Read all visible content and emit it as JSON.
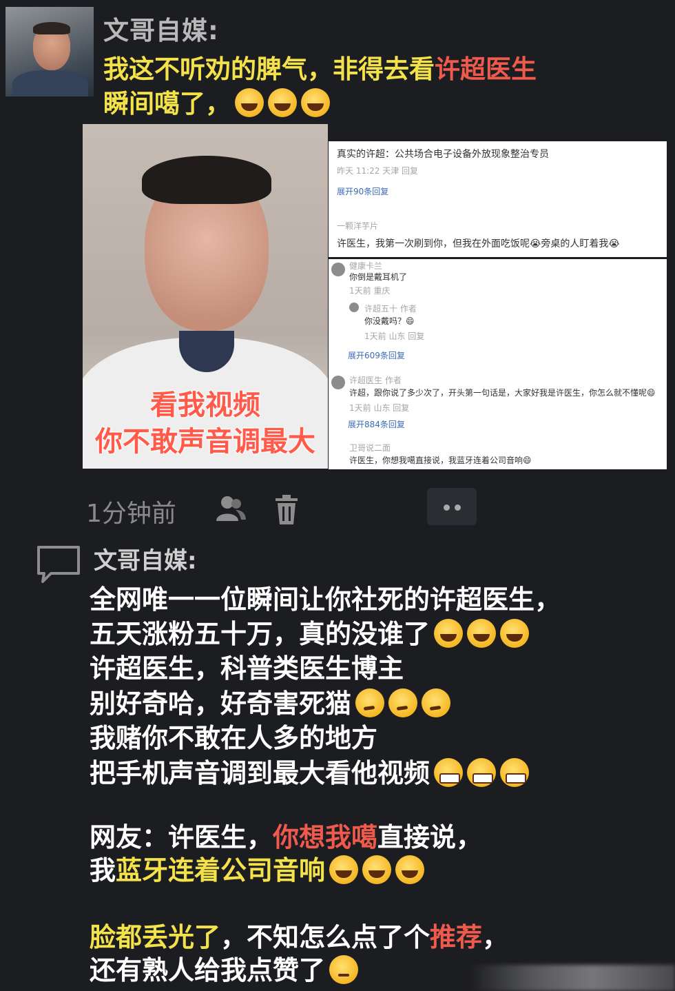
{
  "post1": {
    "author": "文哥自媒:",
    "text_part1": "我这不听劝的脾气，非得去看",
    "text_part2": "许超医生",
    "text_part3": "瞬间噶了，"
  },
  "video": {
    "caption_line1": "看我视频",
    "caption_line2": "你不敢声音调最大"
  },
  "comments": [
    {
      "user": "真实的许超：公共场合电子设备外放现象整治专员",
      "meta": "昨天 11:22  天津    回复",
      "expand": "展开90条回复"
    },
    {
      "user": "一颗洋芋片",
      "text": "许医生，我第一次刷到你，但我在外面吃饭呢😭旁桌的人盯着我😭"
    },
    {
      "user": "健康卡兰",
      "text": "你倒是戴耳机了",
      "meta": "1天前  重庆"
    },
    {
      "user": "许超五十 作者",
      "text": "你没戴吗？😄",
      "meta": "1天前  山东    回复",
      "expand": "展开609条回复"
    },
    {
      "user": "许超医生 作者",
      "text": "许超，跟你说了多少次了，开头第一句话是，大家好我是许医生，你怎么就不懂呢😄",
      "meta": "1天前  山东    回复",
      "expand": "展开884条回复"
    },
    {
      "user": "卫哥说二面",
      "text": "许医生，你想我噶直接说，我蓝牙连着公司音响😄"
    }
  ],
  "meta_row": {
    "time": "1分钟前"
  },
  "post2": {
    "author": "文哥自媒:",
    "line1": "全网唯一一位瞬间让你社死的许超医生，",
    "line2": "五天涨粉五十万，真的没谁了",
    "line3": "许超医生，科普类医生博主",
    "line4": "别好奇哈，好奇害死猫",
    "line5": "我赌你不敢在人多的地方",
    "line6": "把手机声音调到最大看他视频",
    "line7_a": "网友：许医生，",
    "line7_b": "你想我噶",
    "line7_c": "直接说，",
    "line8_a": "我",
    "line8_b": "蓝牙连着公司音响",
    "line9_a": "脸都丢光了",
    "line9_b": "，不知怎么点了个",
    "line9_c": "推荐",
    "line9_d": "，",
    "line10": "还有熟人给我点赞了"
  },
  "icons": [
    "people-icon",
    "trash-icon",
    "comment-icon",
    "more-icon"
  ]
}
